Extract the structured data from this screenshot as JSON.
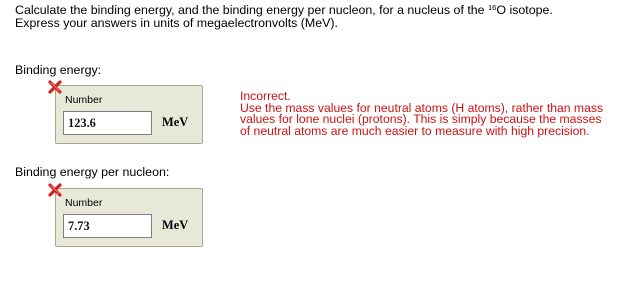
{
  "question": {
    "line1_pre": "Calculate the binding energy, and the binding energy per nucleon, for a nucleus of the ",
    "isotope_mass_number": "16",
    "isotope_symbol": "O",
    "line1_post": " isotope.",
    "line2": "Express your answers in units of megaelectronvolts (MeV)."
  },
  "parts": [
    {
      "label": "Binding energy:",
      "status_icon": "red-x-icon",
      "input_caption": "Number",
      "value": "123.6",
      "unit": "MeV"
    },
    {
      "label": "Binding energy per nucleon:",
      "status_icon": "red-x-icon",
      "input_caption": "Number",
      "value": "7.73",
      "unit": "MeV"
    }
  ],
  "feedback": {
    "title": "Incorrect.",
    "lines": [
      "Use the mass values for neutral atoms (H atoms), rather than mass",
      "values for lone nuclei (protons). This is simply because the masses",
      "of neutral atoms are much easier to measure with high precision."
    ]
  },
  "colors": {
    "error_red": "#cc1111",
    "panel_background": "#e8e8d8",
    "panel_border": "#a9a98e"
  }
}
